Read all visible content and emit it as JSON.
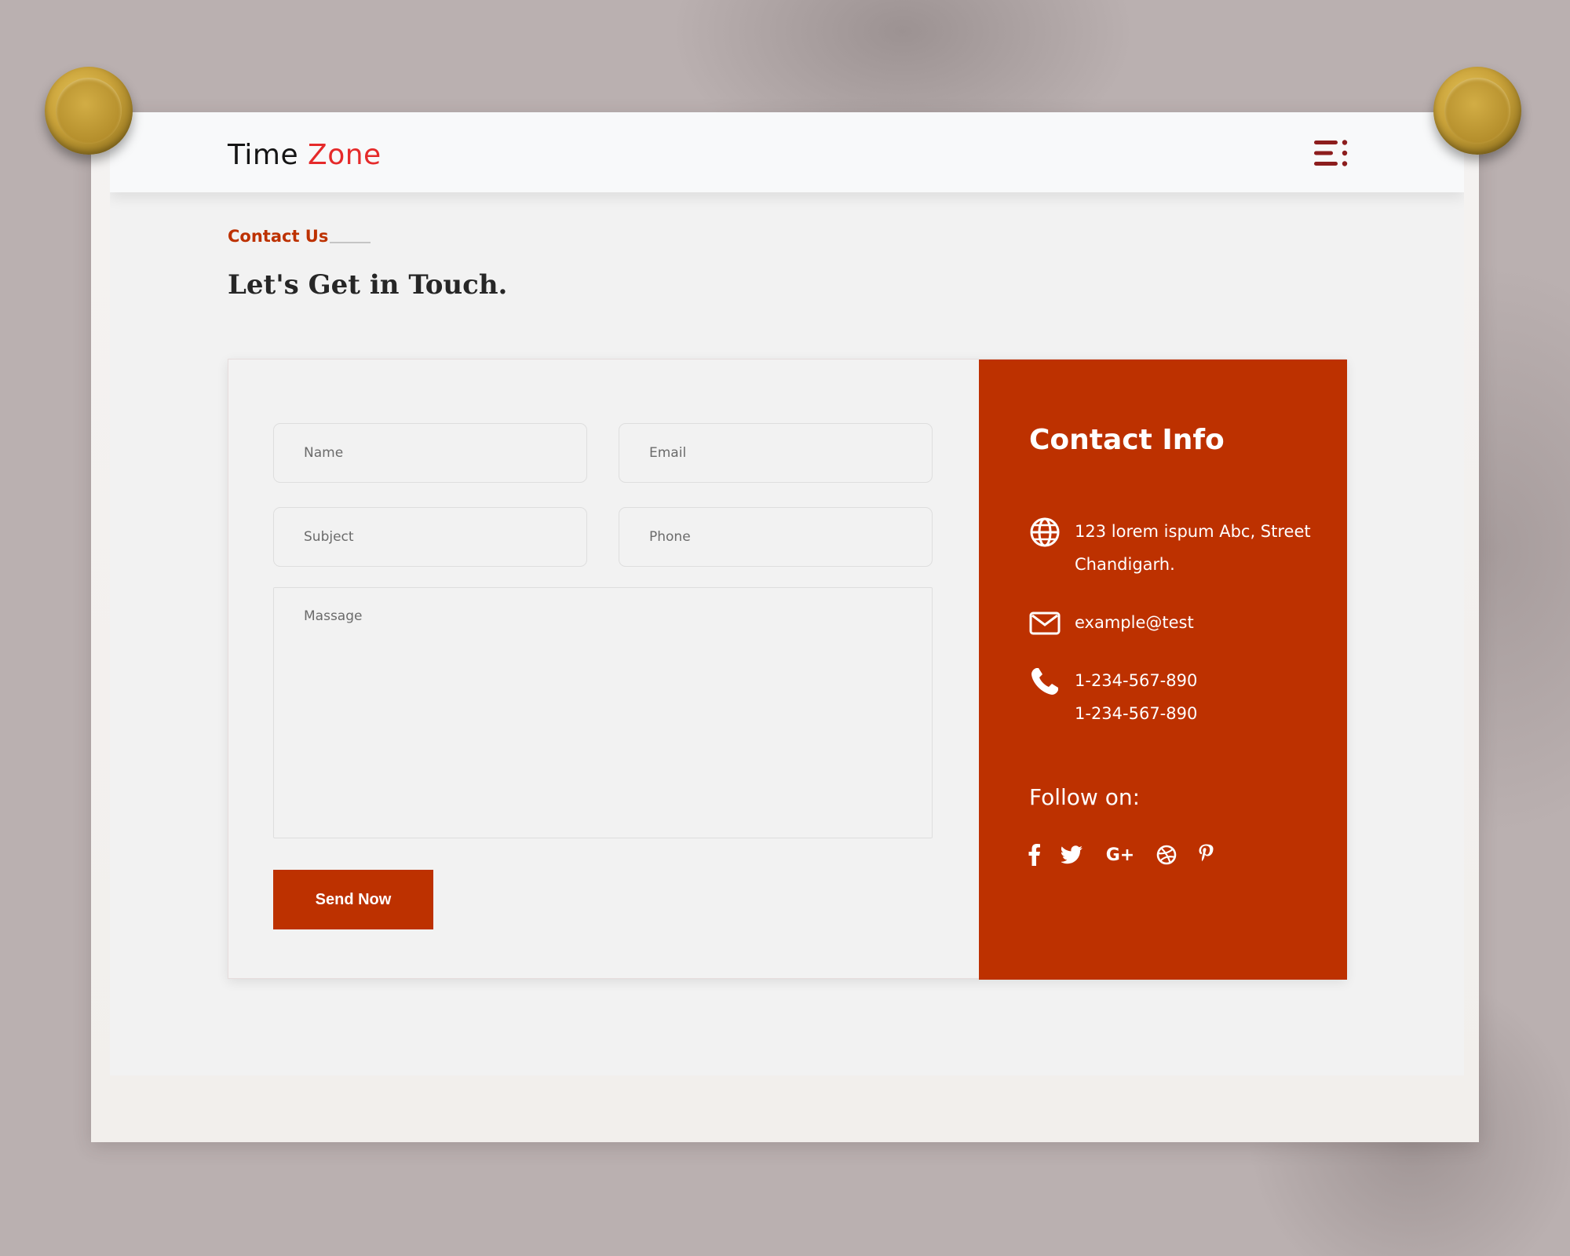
{
  "brand": {
    "word1": "Time ",
    "word2": "Zone"
  },
  "section": {
    "label": "Contact Us",
    "headline": "Let's Get in Touch."
  },
  "form": {
    "name_placeholder": "Name",
    "email_placeholder": "Email",
    "subject_placeholder": "Subject",
    "phone_placeholder": "Phone",
    "message_placeholder": "Massage",
    "submit_label": "Send Now"
  },
  "info": {
    "title": "Contact Info",
    "address_line1": "123 lorem ispum Abc, Street",
    "address_line2": "Chandigarh.",
    "email": "example@test",
    "phone1": "1-234-567-890",
    "phone2": "1-234-567-890",
    "follow_title": "Follow on:",
    "social": [
      {
        "name": "facebook-icon",
        "glyph": "f"
      },
      {
        "name": "twitter-icon",
        "glyph": ""
      },
      {
        "name": "google-plus-icon",
        "glyph": "G+"
      },
      {
        "name": "dribbble-icon",
        "glyph": ""
      },
      {
        "name": "pinterest-icon",
        "glyph": "P"
      }
    ]
  },
  "colors": {
    "accent": "#bd3100",
    "brand_red": "#e52a2a",
    "menu_icon": "#8c1d1d",
    "background": "#f2f2f2"
  }
}
